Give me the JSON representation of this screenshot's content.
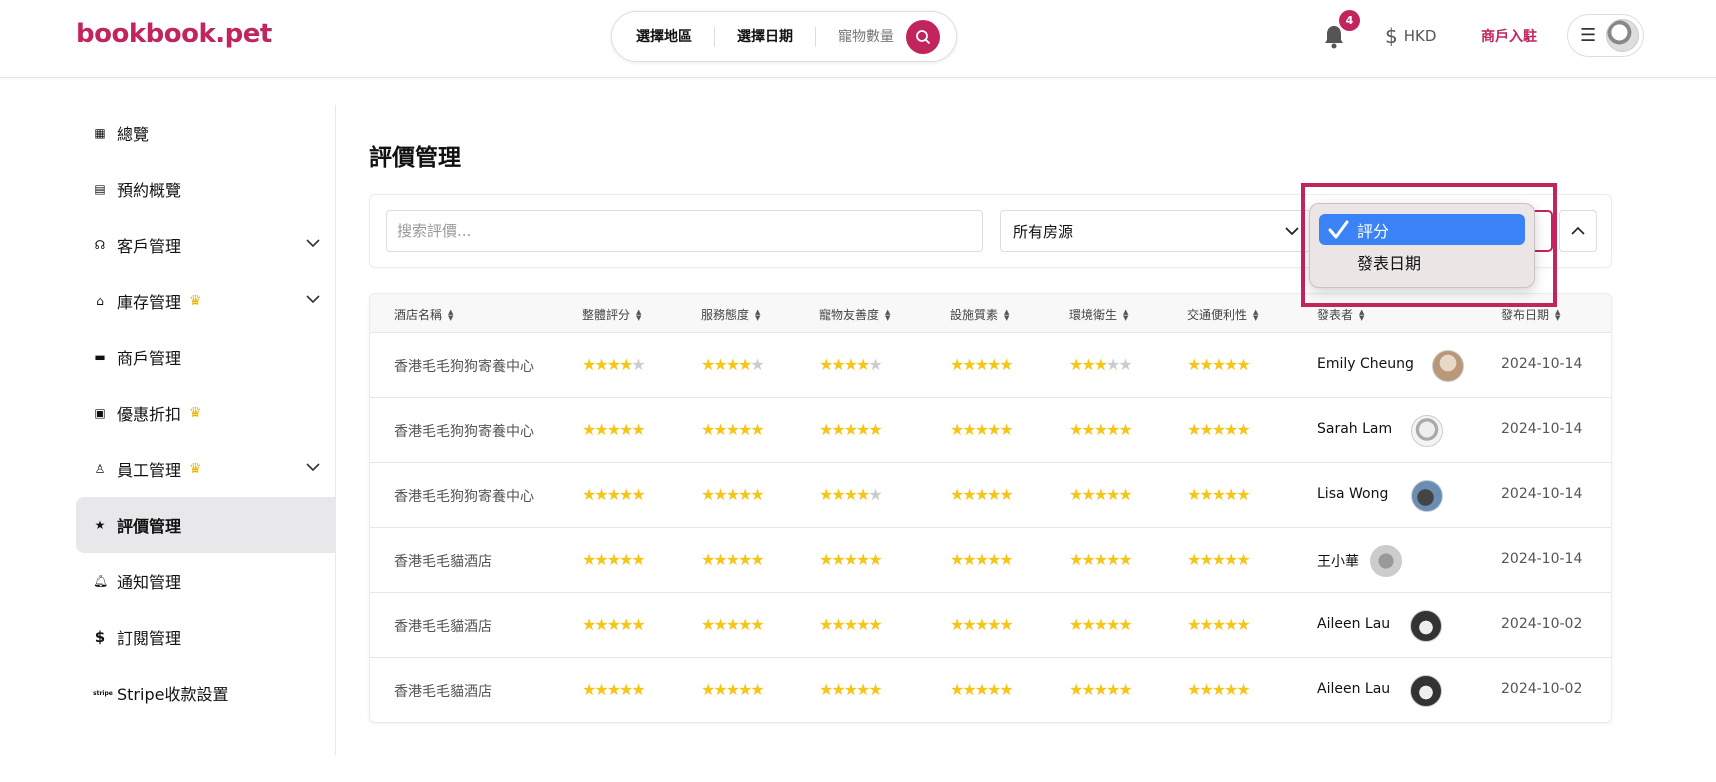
{
  "header": {
    "logo": "bookbook.pet",
    "search": {
      "region": "選擇地區",
      "date": "選擇日期",
      "pets": "寵物數量"
    },
    "notifications_count": "4",
    "currency": "HKD",
    "merchant_link": "商戶入駐"
  },
  "sidebar": {
    "items": [
      {
        "label": "總覽",
        "icon": "dashboard-icon"
      },
      {
        "label": "預約概覽",
        "icon": "calendar-icon"
      },
      {
        "label": "客戶管理",
        "icon": "headset-icon",
        "expandable": true
      },
      {
        "label": "庫存管理",
        "icon": "store-icon",
        "premium": true,
        "expandable": true
      },
      {
        "label": "商戶管理",
        "icon": "shop-icon"
      },
      {
        "label": "優惠折扣",
        "icon": "ticket-icon",
        "premium": true
      },
      {
        "label": "員工管理",
        "icon": "staff-icon",
        "premium": true,
        "expandable": true
      },
      {
        "label": "評價管理",
        "icon": "star-icon",
        "active": true
      },
      {
        "label": "通知管理",
        "icon": "bell-icon"
      },
      {
        "label": "訂閱管理",
        "icon": "dollar-icon"
      },
      {
        "label": "Stripe收款設置",
        "icon": "stripe-icon",
        "icon_text": "stripe"
      }
    ]
  },
  "main": {
    "title": "評價管理",
    "filters": {
      "search_placeholder": "搜索評價...",
      "room_select": "所有房源",
      "sort_options": [
        {
          "label": "評分",
          "selected": true
        },
        {
          "label": "發表日期",
          "selected": false
        }
      ]
    },
    "table": {
      "headers": [
        "酒店名稱",
        "整體評分",
        "服務態度",
        "寵物友善度",
        "設施質素",
        "環境衛生",
        "交通便利性",
        "發表者",
        "發布日期"
      ],
      "rows": [
        {
          "hotel": "香港毛毛狗狗寄養中心",
          "ratings": [
            4,
            4,
            4,
            5,
            3,
            5
          ],
          "author": "Emily Cheung",
          "date": "2024-10-14"
        },
        {
          "hotel": "香港毛毛狗狗寄養中心",
          "ratings": [
            5,
            5,
            5,
            5,
            5,
            5
          ],
          "author": "Sarah Lam",
          "date": "2024-10-14"
        },
        {
          "hotel": "香港毛毛狗狗寄養中心",
          "ratings": [
            5,
            5,
            4,
            5,
            5,
            5
          ],
          "author": "Lisa Wong",
          "date": "2024-10-14"
        },
        {
          "hotel": "香港毛毛貓酒店",
          "ratings": [
            5,
            5,
            5,
            5,
            5,
            5
          ],
          "author": "王小華",
          "date": "2024-10-14"
        },
        {
          "hotel": "香港毛毛貓酒店",
          "ratings": [
            5,
            5,
            5,
            5,
            5,
            5
          ],
          "author": "Aileen Lau",
          "date": "2024-10-02"
        },
        {
          "hotel": "香港毛毛貓酒店",
          "ratings": [
            5,
            5,
            5,
            5,
            5,
            5
          ],
          "author": "Aileen Lau",
          "date": "2024-10-02"
        }
      ]
    }
  },
  "colors": {
    "brand": "#c2255c",
    "star": "#f5c518",
    "select_highlight": "#3b82f6"
  }
}
